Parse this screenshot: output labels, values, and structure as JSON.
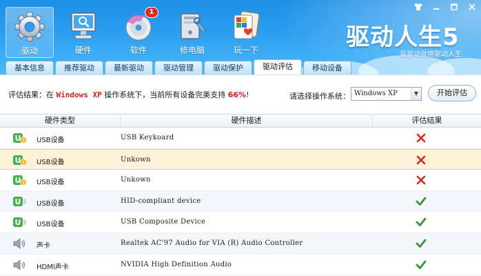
{
  "app": {
    "logo_text": "驱动人生5",
    "slogan": "装驱动就用驱动人生",
    "accent_color": "#2d9ef0"
  },
  "window_controls": [
    "shirt-icon",
    "minimize-icon",
    "maximize-icon",
    "close-icon"
  ],
  "toolbar": [
    {
      "label": "驱动",
      "icon": "gear-icon",
      "active": true
    },
    {
      "label": "硬件",
      "icon": "monitor-icon"
    },
    {
      "label": "软件",
      "icon": "disc-icon",
      "badge": "1"
    },
    {
      "label": "修电脑",
      "icon": "toolbox-icon"
    },
    {
      "label": "玩一下",
      "icon": "cards-icon"
    }
  ],
  "tabs": [
    {
      "label": "基本信息"
    },
    {
      "label": "推荐驱动"
    },
    {
      "label": "最新驱动"
    },
    {
      "label": "驱动管理"
    },
    {
      "label": "驱动保护"
    },
    {
      "label": "驱动评估",
      "active": true
    },
    {
      "label": "移动设备"
    }
  ],
  "evaluation": {
    "prefix": "评估结果：在 ",
    "os": "Windows XP",
    "middle": " 操作系统下，当前所有设备完美支持 ",
    "percent": "66%",
    "suffix": "!",
    "select_label": "请选择操作系统：",
    "select_value": "Windows XP",
    "button_label": "开始评估"
  },
  "table": {
    "headers": [
      "硬件类型",
      "硬件描述",
      "评估结果"
    ],
    "rows": [
      {
        "type": "USB设备",
        "desc": "USB Keykoard",
        "result": "fail",
        "icon": "usb-warning-icon"
      },
      {
        "type": "USB设备",
        "desc": "Unkown",
        "result": "fail",
        "icon": "usb-warning-icon",
        "selected": true
      },
      {
        "type": "USB设备",
        "desc": "Unkown",
        "result": "fail",
        "icon": "usb-warning-icon"
      },
      {
        "type": "USB设备",
        "desc": "HID-compliant device",
        "result": "pass",
        "icon": "usb-icon"
      },
      {
        "type": "USB设备",
        "desc": "USB Composite Device",
        "result": "pass",
        "icon": "usb-icon"
      },
      {
        "type": "声卡",
        "desc": "Realtek AC'97 Audio for VIA (R) Audio Controller",
        "result": "pass",
        "icon": "speaker-icon"
      },
      {
        "type": "HDMI声卡",
        "desc": "NVIDIA High Definition Audio",
        "result": "pass",
        "icon": "speaker-icon"
      }
    ]
  }
}
